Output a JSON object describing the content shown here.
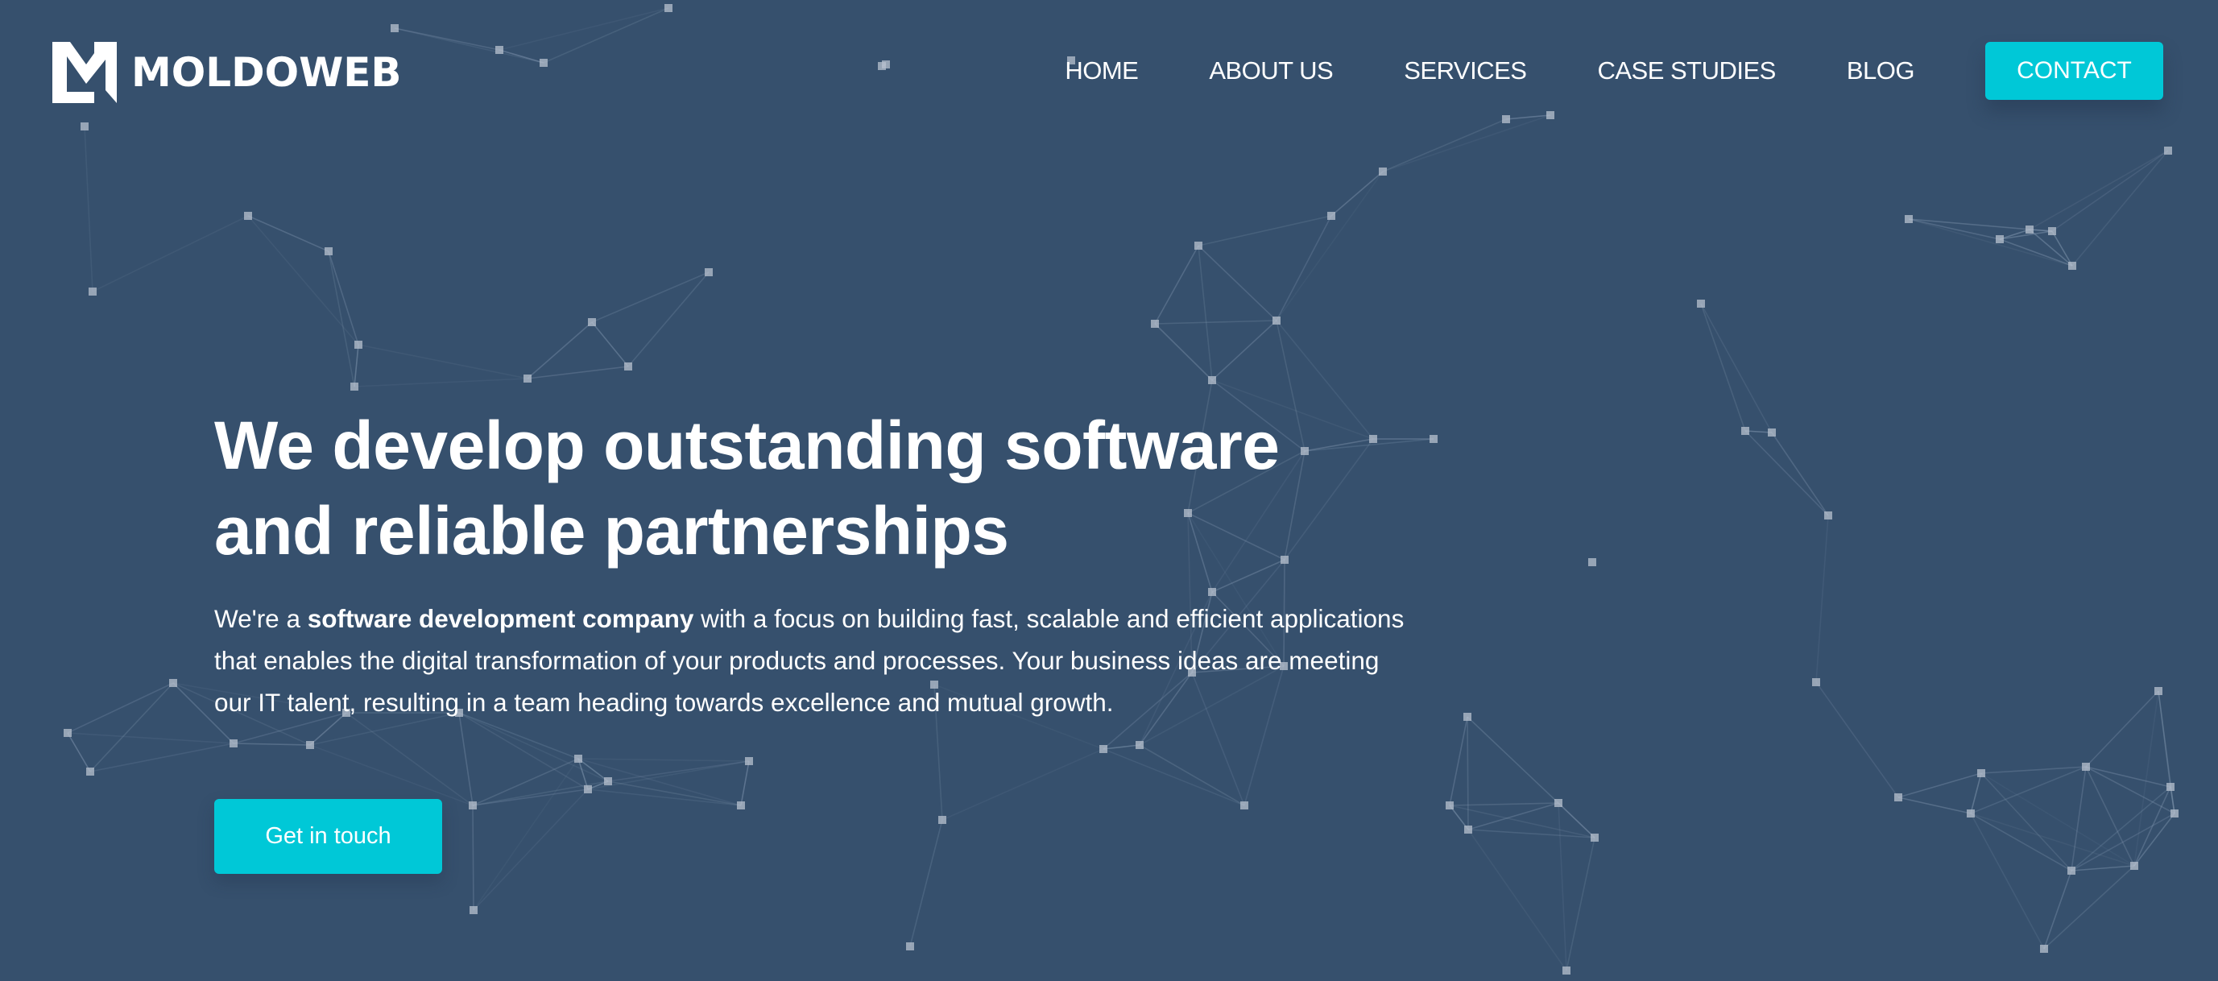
{
  "brand": {
    "name": "MOLDOWEB",
    "logo_icon": "m-logo-icon"
  },
  "nav": {
    "items": [
      {
        "label": "HOME"
      },
      {
        "label": "ABOUT US"
      },
      {
        "label": "SERVICES"
      },
      {
        "label": "CASE STUDIES"
      },
      {
        "label": "BLOG"
      }
    ],
    "contact_label": "CONTACT"
  },
  "hero": {
    "title_line1": "We develop outstanding software",
    "title_line2": "and reliable partnerships",
    "text_intro": "We're a ",
    "text_bold": "software development company",
    "text_rest": " with a focus on building fast, scalable and efficient applications that enables the digital transformation of your products and processes. Your business ideas are meeting our IT talent, resulting in a team heading towards excellence and mutual growth.",
    "cta_label": "Get in touch"
  },
  "colors": {
    "background": "#36506d",
    "accent": "#00c8d7",
    "text": "#ffffff"
  },
  "background_decoration": "network-particles"
}
